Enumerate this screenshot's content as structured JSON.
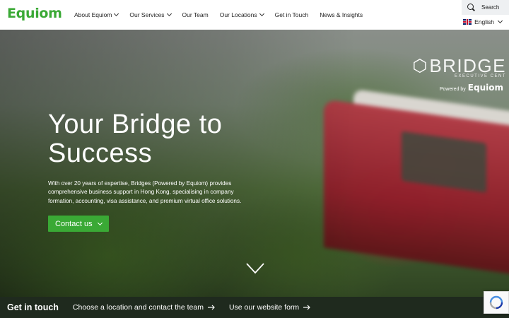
{
  "header": {
    "logo": "Equiom",
    "nav": [
      {
        "label": "About Equiom",
        "has_dropdown": true
      },
      {
        "label": "Our Services",
        "has_dropdown": true
      },
      {
        "label": "Our Team",
        "has_dropdown": false
      },
      {
        "label": "Our Locations",
        "has_dropdown": true
      },
      {
        "label": "Get in Touch",
        "has_dropdown": false
      },
      {
        "label": "News & Insights",
        "has_dropdown": false
      }
    ],
    "search_label": "Search",
    "language": "English"
  },
  "hero": {
    "title_line1": "Your Bridge to",
    "title_line2": "Success",
    "description": "With over 20 years of expertise, Bridges (Powered by Equiom) provides comprehensive business support in Hong Kong, specialising in company formation, accounting, visa assistance, and premium virtual office solutions.",
    "cta_label": "Contact us",
    "brand_word": "BRIDGE",
    "brand_sub": "EXECUTIVE CENT",
    "powered_by": "Powered by",
    "powered_brand": "Equiom"
  },
  "footer_bar": {
    "title": "Get in touch",
    "links": [
      {
        "label": "Choose a location and contact the team"
      },
      {
        "label": "Use our website form"
      }
    ]
  },
  "colors": {
    "brand_green": "#3aa935",
    "footer_bg": "#1f2a1e"
  },
  "icons": {
    "search": "search-icon",
    "language_flag": "uk-flag-icon",
    "scroll_down": "chevron-down-icon",
    "arrow": "arrow-right-icon",
    "recaptcha": "recaptcha-icon"
  }
}
